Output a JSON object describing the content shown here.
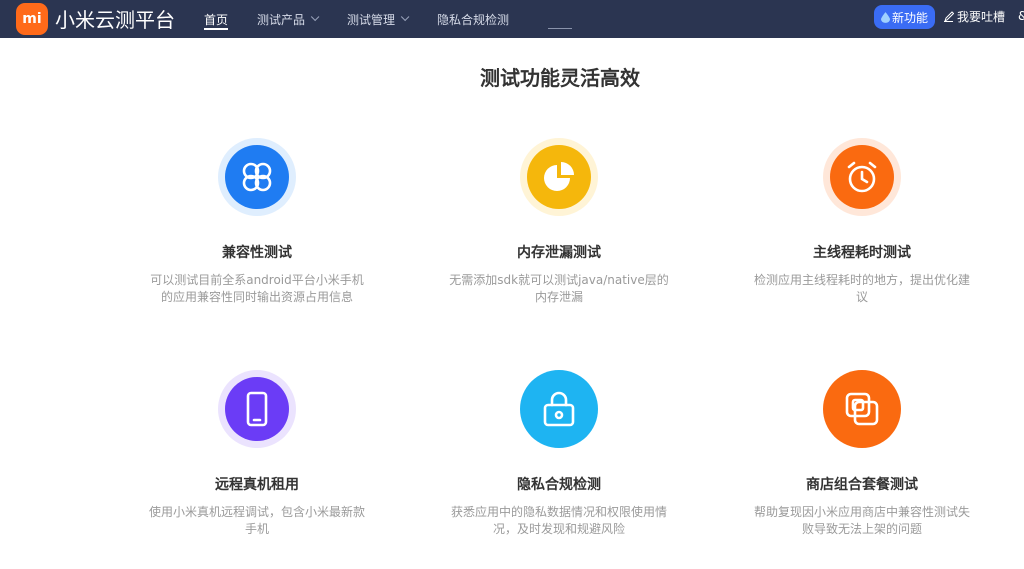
{
  "header": {
    "logo_mark": "mi",
    "brand": "小米云测平台",
    "nav": [
      {
        "label": "首页",
        "active": true,
        "dropdown": false
      },
      {
        "label": "测试产品",
        "active": false,
        "dropdown": true
      },
      {
        "label": "测试管理",
        "active": false,
        "dropdown": true
      },
      {
        "label": "隐私合规检测",
        "active": false,
        "dropdown": false
      }
    ],
    "new_feature_label": "新功能",
    "feedback_label": "我要吐槽",
    "edge_char": "&"
  },
  "main": {
    "section_title": "测试功能灵活高效",
    "features": [
      {
        "icon": "clover-icon",
        "color": "#1f7cf2",
        "title": "兼容性测试",
        "desc": "可以测试目前全系android平台小米手机的应用兼容性同时输出资源占用信息"
      },
      {
        "icon": "pie-chart-icon",
        "color": "#f5b70c",
        "title": "内存泄漏测试",
        "desc": "无需添加sdk就可以测试java/native层的内存泄漏"
      },
      {
        "icon": "alarm-clock-icon",
        "color": "#fa6a10",
        "title": "主线程耗时测试",
        "desc": "检测应用主线程耗时的地方，提出优化建议"
      },
      {
        "icon": "phone-icon",
        "color": "#6b3cf6",
        "title": "远程真机租用",
        "desc": "使用小米真机远程调试，包含小米最新款手机"
      },
      {
        "icon": "lock-icon",
        "color": "#1eb4f2",
        "title": "隐私合规检测",
        "desc": "获悉应用中的隐私数据情况和权限使用情况，及时发现和规避风险"
      },
      {
        "icon": "combo-squares-icon",
        "color": "#fa6a10",
        "title": "商店组合套餐测试",
        "desc": "帮助复现因小米应用商店中兼容性测试失败导致无法上架的问题"
      }
    ]
  }
}
